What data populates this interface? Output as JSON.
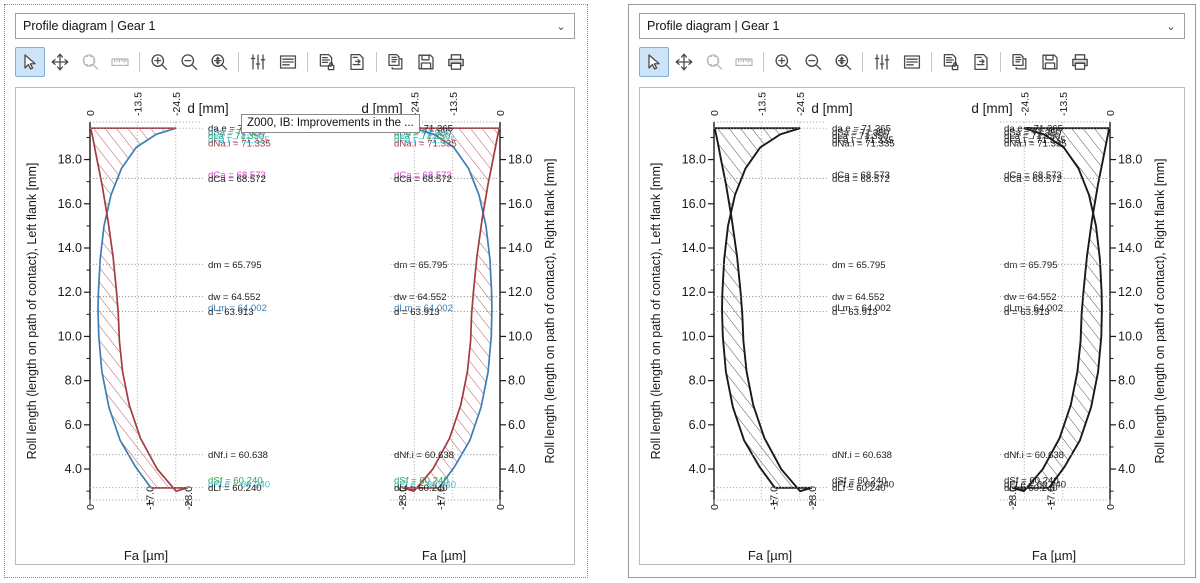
{
  "panels": [
    {
      "id": "left",
      "mode": "color",
      "combo": {
        "value": "Profile diagram | Gear 1",
        "arrow": "⌄"
      },
      "toolbar": {
        "buttons": [
          {
            "name": "select-tool",
            "label": "Select",
            "icon": "cursor-arrow-icon",
            "active": true,
            "disabled": false
          },
          {
            "name": "pan-tool",
            "label": "Pan",
            "icon": "move-arrows-icon",
            "active": false,
            "disabled": false
          },
          {
            "name": "zoom-window-tool",
            "label": "Zoom window",
            "icon": "zoom-window-icon",
            "active": false,
            "disabled": true
          },
          {
            "name": "measure-tool",
            "label": "Measure",
            "icon": "ruler-icon",
            "active": false,
            "disabled": true
          },
          {
            "name": "zoom-in-button",
            "label": "Zoom in",
            "icon": "magnifier-plus-icon",
            "active": false,
            "disabled": false
          },
          {
            "name": "zoom-out-button",
            "label": "Zoom out",
            "icon": "magnifier-minus-icon",
            "active": false,
            "disabled": false
          },
          {
            "name": "zoom-fit-button",
            "label": "Zoom to fit",
            "icon": "magnifier-fit-icon",
            "active": false,
            "disabled": false
          },
          {
            "name": "properties-button",
            "label": "Graphics properties",
            "icon": "sliders-icon",
            "active": false,
            "disabled": false
          },
          {
            "name": "comment-button",
            "label": "Comment",
            "icon": "text-lines-icon",
            "active": false,
            "disabled": false
          },
          {
            "name": "save-protected-button",
            "label": "Save protected",
            "icon": "document-lock-icon",
            "active": false,
            "disabled": false
          },
          {
            "name": "import-document-button",
            "label": "Import",
            "icon": "document-in-icon",
            "active": false,
            "disabled": false
          },
          {
            "name": "copy-button",
            "label": "Copy",
            "icon": "copy-pages-icon",
            "active": false,
            "disabled": false
          },
          {
            "name": "save-button",
            "label": "Save",
            "icon": "floppy-disk-icon",
            "active": false,
            "disabled": false
          },
          {
            "name": "print-button",
            "label": "Print",
            "icon": "printer-icon",
            "active": false,
            "disabled": false
          }
        ]
      },
      "tooltip": {
        "visible": true,
        "text": "Z000, IB: Improvements in the ..."
      }
    },
    {
      "id": "right",
      "mode": "mono",
      "combo": {
        "value": "Profile diagram | Gear 1",
        "arrow": "⌄"
      },
      "toolbar": {
        "buttons": [
          {
            "name": "select-tool",
            "label": "Select",
            "icon": "cursor-arrow-icon",
            "active": true,
            "disabled": false
          },
          {
            "name": "pan-tool",
            "label": "Pan",
            "icon": "move-arrows-icon",
            "active": false,
            "disabled": false
          },
          {
            "name": "zoom-window-tool",
            "label": "Zoom window",
            "icon": "zoom-window-icon",
            "active": false,
            "disabled": true
          },
          {
            "name": "measure-tool",
            "label": "Measure",
            "icon": "ruler-icon",
            "active": false,
            "disabled": true
          },
          {
            "name": "zoom-in-button",
            "label": "Zoom in",
            "icon": "magnifier-plus-icon",
            "active": false,
            "disabled": false
          },
          {
            "name": "zoom-out-button",
            "label": "Zoom out",
            "icon": "magnifier-minus-icon",
            "active": false,
            "disabled": false
          },
          {
            "name": "zoom-fit-button",
            "label": "Zoom to fit",
            "icon": "magnifier-fit-icon",
            "active": false,
            "disabled": false
          },
          {
            "name": "properties-button",
            "label": "Graphics properties",
            "icon": "sliders-icon",
            "active": false,
            "disabled": false
          },
          {
            "name": "comment-button",
            "label": "Comment",
            "icon": "text-lines-icon",
            "active": false,
            "disabled": false
          },
          {
            "name": "save-protected-button",
            "label": "Save protected",
            "icon": "document-lock-icon",
            "active": false,
            "disabled": false
          },
          {
            "name": "import-document-button",
            "label": "Import",
            "icon": "document-in-icon",
            "active": false,
            "disabled": false
          },
          {
            "name": "copy-button",
            "label": "Copy",
            "icon": "copy-pages-icon",
            "active": false,
            "disabled": false
          },
          {
            "name": "save-button",
            "label": "Save",
            "icon": "floppy-disk-icon",
            "active": false,
            "disabled": false
          },
          {
            "name": "print-button",
            "label": "Print",
            "icon": "printer-icon",
            "active": false,
            "disabled": false
          }
        ]
      },
      "tooltip": {
        "visible": false,
        "text": ""
      }
    }
  ],
  "chart_data": {
    "type": "line",
    "title": "Profile diagram | Gear 1",
    "subcharts": [
      {
        "id": "left-flank",
        "xlabel": "Fa [µm]",
        "toplabel": "d [mm]",
        "ylabel": "Roll length (length on path of contact), Left flank [mm]",
        "y_side": "left",
        "x_direction": "ltr"
      },
      {
        "id": "right-flank",
        "xlabel": "Fa [µm]",
        "toplabel": "d [mm]",
        "ylabel": "Roll length (length on path of contact), Right flank [mm]",
        "y_side": "right",
        "x_direction": "rtl"
      }
    ],
    "ylim": [
      2.6,
      19.7
    ],
    "yticks": [
      4.0,
      6.0,
      8.0,
      10.0,
      12.0,
      14.0,
      16.0,
      18.0
    ],
    "yticklabels": [
      "4.0",
      "6.0",
      "8.0",
      "10.0",
      "12.0",
      "14.0",
      "16.0",
      "18.0"
    ],
    "xlim": [
      0,
      -32
    ],
    "xticks": [
      0,
      -17.0,
      -28.0
    ],
    "xticklabels": [
      "0",
      "-17.0",
      "-28.0"
    ],
    "top_xticks": [
      0,
      -13.5,
      -24.5
    ],
    "top_xticklabels": [
      "0",
      "-13.5",
      "-24.5"
    ],
    "grid": true,
    "series": [
      {
        "name": "tolerance-upper-blue",
        "color": "#3b7fb5",
        "points": [
          [
            -24.6,
            19.42
          ],
          [
            -19.0,
            19.15
          ],
          [
            -13.2,
            18.55
          ],
          [
            -9.0,
            17.6
          ],
          [
            -6.0,
            16.4
          ],
          [
            -4.0,
            15.0
          ],
          [
            -2.9,
            13.5
          ],
          [
            -2.4,
            12.0
          ],
          [
            -2.3,
            11.2
          ],
          [
            -2.5,
            10.0
          ],
          [
            -3.4,
            8.4
          ],
          [
            -5.4,
            6.8
          ],
          [
            -8.6,
            5.3
          ],
          [
            -13.0,
            4.1
          ],
          [
            -17.4,
            3.15
          ]
        ]
      },
      {
        "name": "tolerance-lower-red",
        "color": "#a33b42",
        "points": [
          [
            -0.2,
            19.42
          ],
          [
            -0.9,
            18.9
          ],
          [
            -2.0,
            18.0
          ],
          [
            -3.4,
            16.9
          ],
          [
            -5.1,
            15.3
          ],
          [
            -6.6,
            13.6
          ],
          [
            -7.6,
            12.0
          ],
          [
            -8.1,
            11.0
          ],
          [
            -8.4,
            9.8
          ],
          [
            -9.3,
            8.4
          ],
          [
            -11.2,
            6.9
          ],
          [
            -14.4,
            5.4
          ],
          [
            -19.2,
            4.0
          ],
          [
            -24.6,
            3.0
          ],
          [
            -27.9,
            3.15
          ]
        ]
      }
    ],
    "hatch": {
      "style": "diagonal-lines",
      "color_left_panel": "#b8585e",
      "color_right_panel": "#555555"
    },
    "annotations_top": [
      {
        "label": "da.e",
        "value": "71.365",
        "text": "da.e = 71.365",
        "color": "#1a1a1a",
        "y": 19.42,
        "marker": true
      },
      {
        "label": "dSa",
        "value": "71.350",
        "text": "dSa  = 71.350",
        "color": "#3b7fb5",
        "y": 19.25,
        "marker": false
      },
      {
        "label": "dLa",
        "value": "71.350",
        "text": "dLa  = 71.350",
        "color": "#2f9e4f",
        "y": 19.08,
        "marker": false
      },
      {
        "label": "dFa.i",
        "value": "71.335",
        "text": "dFa.i = 71.335",
        "color": "#35c4d8",
        "y": 18.91,
        "marker": false
      },
      {
        "label": "dNa.i",
        "value": "71.335",
        "text": "dNa.i = 71.335",
        "color": "#a33b42",
        "y": 18.74,
        "marker": false
      },
      {
        "label": "dCa",
        "value": "68.573",
        "text": "dCa = 68.573",
        "color": "#d045c7",
        "y": 17.32,
        "marker": false
      },
      {
        "label": "dCa",
        "value": "68.572",
        "text": "dCa = 68.572",
        "color": "#1a1a1a",
        "y": 17.15,
        "marker": true
      }
    ],
    "annotations_mid": [
      {
        "label": "dm",
        "value": "65.795",
        "text": "dm = 65.795",
        "color": "#1a1a1a",
        "y": 13.26,
        "marker": true
      },
      {
        "label": "dw",
        "value": "64.552",
        "text": "dw = 64.552",
        "color": "#1a1a1a",
        "y": 11.8,
        "marker": true
      },
      {
        "label": "dLm",
        "value": "64.002",
        "text": "dLm = 64.002",
        "color": "#3b7fb5",
        "y": 11.3,
        "marker": false
      },
      {
        "label": "d",
        "value": "63.913",
        "text": "d = 63.913",
        "color": "#1a1a1a",
        "y": 11.13,
        "marker": true
      }
    ],
    "annotations_bottom": [
      {
        "label": "dNf.i",
        "value": "60.638",
        "text": "dNf.i = 60.638",
        "color": "#1a1a1a",
        "y": 4.65,
        "marker": true
      },
      {
        "label": "dSf",
        "value": "60.240",
        "text": "dSf  = 60.240",
        "color": "#2f9e4f",
        "y": 3.5,
        "marker": false
      },
      {
        "label": "dFf.e",
        "value": "60.240",
        "text": "dFf.e = 60.240",
        "color": "#35c4d8",
        "y": 3.33,
        "marker": false
      },
      {
        "label": "dLf",
        "value": "60.240",
        "text": "dLf  = 60.240",
        "color": "#1a1a1a",
        "y": 3.16,
        "marker": true
      }
    ]
  }
}
